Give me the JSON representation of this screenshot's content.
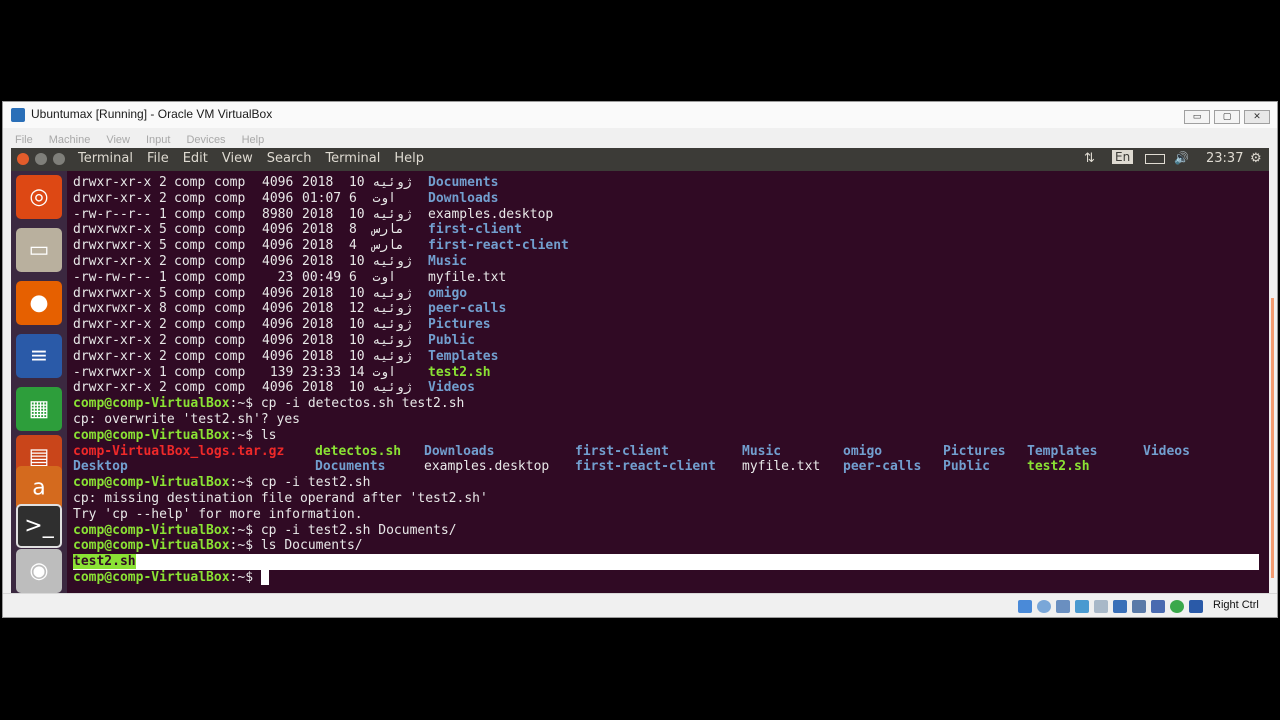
{
  "window": {
    "title": "Ubuntumax [Running] - Oracle VM VirtualBox",
    "controls": [
      "▭",
      "▢",
      "✕"
    ]
  },
  "vbox_menu": [
    "File",
    "Machine",
    "View",
    "Input",
    "Devices",
    "Help"
  ],
  "ubuntu_topbar": {
    "menus": [
      "Terminal",
      "File",
      "Edit",
      "View",
      "Search",
      "Terminal",
      "Help"
    ],
    "indicators": {
      "network": "⇅",
      "keyboard": "En",
      "volume": "🔊",
      "time": "23:37",
      "settings": "⚙"
    }
  },
  "launcher": {
    "items": [
      {
        "name": "ubuntu-dash",
        "glyph": "◎",
        "color": "#dd4814"
      },
      {
        "name": "files",
        "glyph": "▭",
        "color": "#b9b09e"
      },
      {
        "name": "firefox",
        "glyph": "●",
        "color": "#e66000"
      },
      {
        "name": "writer",
        "glyph": "≡",
        "color": "#2a5aa8"
      },
      {
        "name": "calc",
        "glyph": "▦",
        "color": "#2d9e3b"
      },
      {
        "name": "impress",
        "glyph": "▤",
        "color": "#c9451a"
      },
      {
        "name": "software",
        "glyph": "a",
        "color": "#d46a1e"
      },
      {
        "name": "terminal",
        "glyph": ">_",
        "color": "#2f2f2f"
      },
      {
        "name": "dvd",
        "glyph": "◉",
        "color": "#bdbdbd"
      }
    ]
  },
  "terminal": {
    "listing": [
      {
        "perms": "drwxr-xr-x",
        "links": "2",
        "user": "comp",
        "group": "comp",
        "size": "4096",
        "date": "ژوئیه 10  2018",
        "name": "Documents",
        "type": "dir"
      },
      {
        "perms": "drwxr-xr-x",
        "links": "2",
        "user": "comp",
        "group": "comp",
        "size": "4096",
        "date": "اوت  6 01:07",
        "name": "Downloads",
        "type": "dir"
      },
      {
        "perms": "-rw-r--r--",
        "links": "1",
        "user": "comp",
        "group": "comp",
        "size": "8980",
        "date": "ژوئیه 10  2018",
        "name": "examples.desktop",
        "type": "file"
      },
      {
        "perms": "drwxrwxr-x",
        "links": "5",
        "user": "comp",
        "group": "comp",
        "size": "4096",
        "date": "مارس  8  2018",
        "name": "first-client",
        "type": "dir"
      },
      {
        "perms": "drwxrwxr-x",
        "links": "5",
        "user": "comp",
        "group": "comp",
        "size": "4096",
        "date": "مارس  4  2018",
        "name": "first-react-client",
        "type": "dir"
      },
      {
        "perms": "drwxr-xr-x",
        "links": "2",
        "user": "comp",
        "group": "comp",
        "size": "4096",
        "date": "ژوئیه 10  2018",
        "name": "Music",
        "type": "dir"
      },
      {
        "perms": "-rw-rw-r--",
        "links": "1",
        "user": "comp",
        "group": "comp",
        "size": "  23",
        "date": "اوت  6 00:49",
        "name": "myfile.txt",
        "type": "file"
      },
      {
        "perms": "drwxrwxr-x",
        "links": "5",
        "user": "comp",
        "group": "comp",
        "size": "4096",
        "date": "ژوئیه 10  2018",
        "name": "omigo",
        "type": "dir"
      },
      {
        "perms": "drwxrwxr-x",
        "links": "8",
        "user": "comp",
        "group": "comp",
        "size": "4096",
        "date": "ژوئیه 12  2018",
        "name": "peer-calls",
        "type": "dir"
      },
      {
        "perms": "drwxr-xr-x",
        "links": "2",
        "user": "comp",
        "group": "comp",
        "size": "4096",
        "date": "ژوئیه 10  2018",
        "name": "Pictures",
        "type": "dir"
      },
      {
        "perms": "drwxr-xr-x",
        "links": "2",
        "user": "comp",
        "group": "comp",
        "size": "4096",
        "date": "ژوئیه 10  2018",
        "name": "Public",
        "type": "dir"
      },
      {
        "perms": "drwxr-xr-x",
        "links": "2",
        "user": "comp",
        "group": "comp",
        "size": "4096",
        "date": "ژوئیه 10  2018",
        "name": "Templates",
        "type": "dir"
      },
      {
        "perms": "-rwxrwxr-x",
        "links": "1",
        "user": "comp",
        "group": "comp",
        "size": " 139",
        "date": "اوت 14 23:33",
        "name": "test2.sh",
        "type": "exe"
      },
      {
        "perms": "drwxr-xr-x",
        "links": "2",
        "user": "comp",
        "group": "comp",
        "size": "4096",
        "date": "ژوئیه 10  2018",
        "name": "Videos",
        "type": "dir"
      }
    ],
    "prompt_user": "comp@comp-VirtualBox",
    "prompt_path": ":~$ ",
    "cmd1": "cp -i detectos.sh test2.sh",
    "out1": "cp: overwrite 'test2.sh'? yes",
    "cmd2": "ls",
    "ls_row1": [
      {
        "t": "comp-VirtualBox_logs.tar.gz",
        "k": "arc"
      },
      {
        "t": "detectos.sh",
        "k": "exe"
      },
      {
        "t": "Downloads",
        "k": "dir"
      },
      {
        "t": "first-client",
        "k": "dir"
      },
      {
        "t": "Music",
        "k": "dir"
      },
      {
        "t": "omigo",
        "k": "dir"
      },
      {
        "t": "Pictures",
        "k": "dir"
      },
      {
        "t": "Templates",
        "k": "dir"
      },
      {
        "t": "Videos",
        "k": "dir"
      }
    ],
    "ls_row2": [
      {
        "t": "Desktop",
        "k": "dir"
      },
      {
        "t": "Documents",
        "k": "dir"
      },
      {
        "t": "examples.desktop",
        "k": "file"
      },
      {
        "t": "first-react-client",
        "k": "dir"
      },
      {
        "t": "myfile.txt",
        "k": "file"
      },
      {
        "t": "peer-calls",
        "k": "dir"
      },
      {
        "t": "Public",
        "k": "dir"
      },
      {
        "t": "test2.sh",
        "k": "exe"
      }
    ],
    "cmd3": "cp -i test2.sh",
    "err1": "cp: missing destination file operand after 'test2.sh'",
    "err2": "Try 'cp --help' for more information.",
    "cmd4": "cp -i test2.sh Documents/",
    "cmd5": "ls Documents/",
    "out5": "test2.sh"
  },
  "vbox_status": {
    "host_key": "Right Ctrl"
  }
}
